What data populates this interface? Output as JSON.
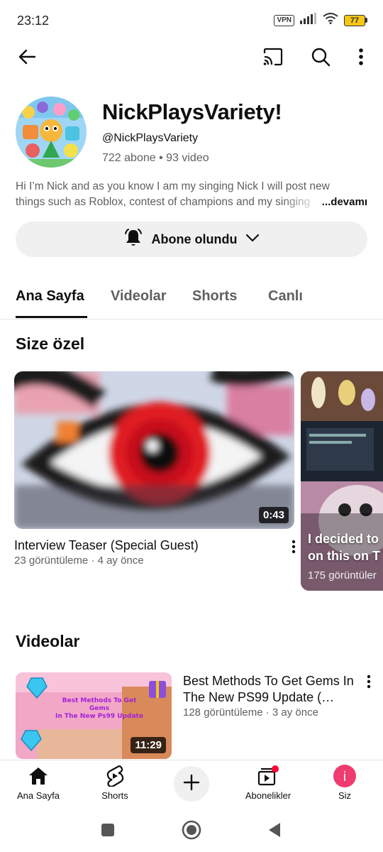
{
  "status_bar": {
    "time": "23:12",
    "vpn": "VPN",
    "battery": "77"
  },
  "app_bar": {
    "icons": [
      "back-arrow-icon",
      "cast-icon",
      "search-icon",
      "more-vert-icon"
    ]
  },
  "channel": {
    "name": "NickPlaysVariety!",
    "handle": "@NickPlaysVariety",
    "stats": "722 abone • 93 video",
    "description_line1": "Hi I’m Nick and as you know I am my singing Nick I will post new",
    "description_line2": "things such as Roblox, contest of champions and my singing",
    "description_more": "...devamı"
  },
  "subscribe": {
    "label": "Abone olundu"
  },
  "tabs": [
    {
      "label": "Ana Sayfa",
      "active": true
    },
    {
      "label": "Videolar",
      "active": false
    },
    {
      "label": "Shorts",
      "active": false
    },
    {
      "label": "Canlı",
      "active": false
    }
  ],
  "for_you": {
    "title": "Size özel",
    "featured": {
      "title": "Interview Teaser (Special Guest)",
      "meta": "23 görüntüleme · 4 ay önce",
      "duration": "0:43"
    },
    "side_card": {
      "title_line1": "I decided to",
      "title_line2": "on this on T",
      "meta": "175 görüntüler"
    }
  },
  "videos": {
    "title": "Videolar",
    "items": [
      {
        "title": "Best Methods To Get Gems In The New PS99 Update (…",
        "meta": "128 görüntüleme · 3 ay önce",
        "duration": "11:29",
        "thumb_text": "Best Methods To Get Gems In The New Ps99 Update"
      }
    ]
  },
  "bottom_nav": {
    "items": [
      {
        "label": "Ana Sayfa",
        "icon": "home-icon"
      },
      {
        "label": "Shorts",
        "icon": "shorts-icon"
      },
      {
        "label": "",
        "icon": "create-plus-icon"
      },
      {
        "label": "Abonelikler",
        "icon": "subscriptions-icon"
      },
      {
        "label": "Siz",
        "icon": "profile-avatar-icon"
      }
    ],
    "avatar_letter": "i"
  },
  "colors": {
    "accent_red": "#ff0033",
    "text_primary": "#0f0f0f",
    "text_secondary": "#606060",
    "chip_bg": "#f0f0f0"
  }
}
